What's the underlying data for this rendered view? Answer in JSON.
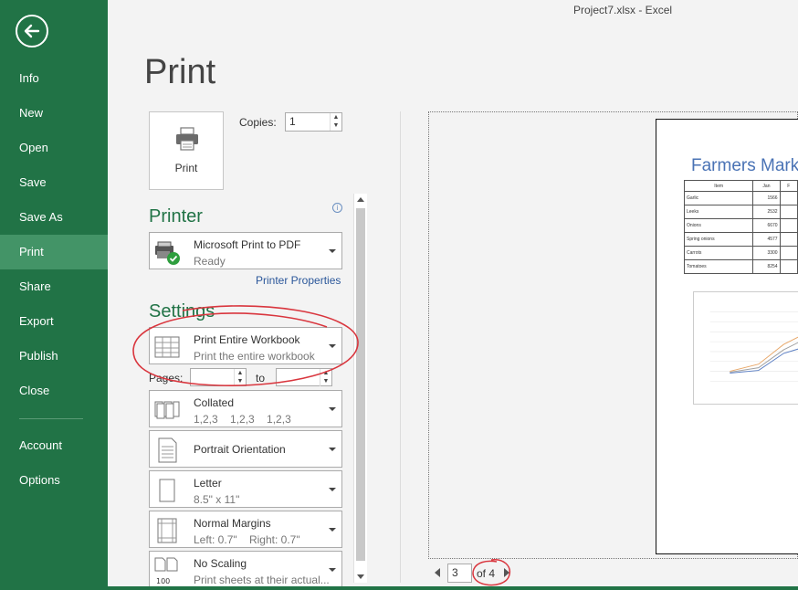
{
  "window_title": "Project7.xlsx - Excel",
  "sidebar": {
    "items": [
      {
        "label": "Info"
      },
      {
        "label": "New"
      },
      {
        "label": "Open"
      },
      {
        "label": "Save"
      },
      {
        "label": "Save As"
      },
      {
        "label": "Print"
      },
      {
        "label": "Share"
      },
      {
        "label": "Export"
      },
      {
        "label": "Publish"
      },
      {
        "label": "Close"
      },
      {
        "label": "Account"
      },
      {
        "label": "Options"
      }
    ],
    "active": "Print"
  },
  "page_title": "Print",
  "print_button_label": "Print",
  "copies": {
    "label": "Copies:",
    "value": "1"
  },
  "printer": {
    "heading": "Printer",
    "name": "Microsoft Print to PDF",
    "status": "Ready",
    "properties_link": "Printer Properties"
  },
  "settings": {
    "heading": "Settings",
    "scope": {
      "title": "Print Entire Workbook",
      "subtitle": "Print the entire workbook"
    },
    "pages_label": "Pages:",
    "to_label": "to",
    "collation": {
      "title": "Collated",
      "subtitle": "1,2,3    1,2,3    1,2,3"
    },
    "orientation": {
      "title": "Portrait Orientation"
    },
    "paper": {
      "title": "Letter",
      "subtitle": "8.5\" x 11\""
    },
    "margins": {
      "title": "Normal Margins",
      "subtitle": "Left: 0.7\"    Right: 0.7\""
    },
    "scaling": {
      "title": "No Scaling",
      "subtitle": "Print sheets at their actual...",
      "icon_text": "100"
    }
  },
  "preview": {
    "sheet_title": "Farmers Mark",
    "table_header": [
      "Item",
      "Jan",
      "F"
    ],
    "rows": [
      [
        "Garlic",
        "1566"
      ],
      [
        "Leeks",
        "2532"
      ],
      [
        "Onions",
        "6670"
      ],
      [
        "Spring onions",
        "4577"
      ],
      [
        "Carrots",
        "3300"
      ],
      [
        "Tomatoes",
        "8254"
      ]
    ]
  },
  "page_nav": {
    "current": "3",
    "total_label": "of 4"
  },
  "colors": {
    "accent": "#217346",
    "active_nav": "#439467",
    "link": "#2b579a",
    "annotation": "#d9363e"
  }
}
